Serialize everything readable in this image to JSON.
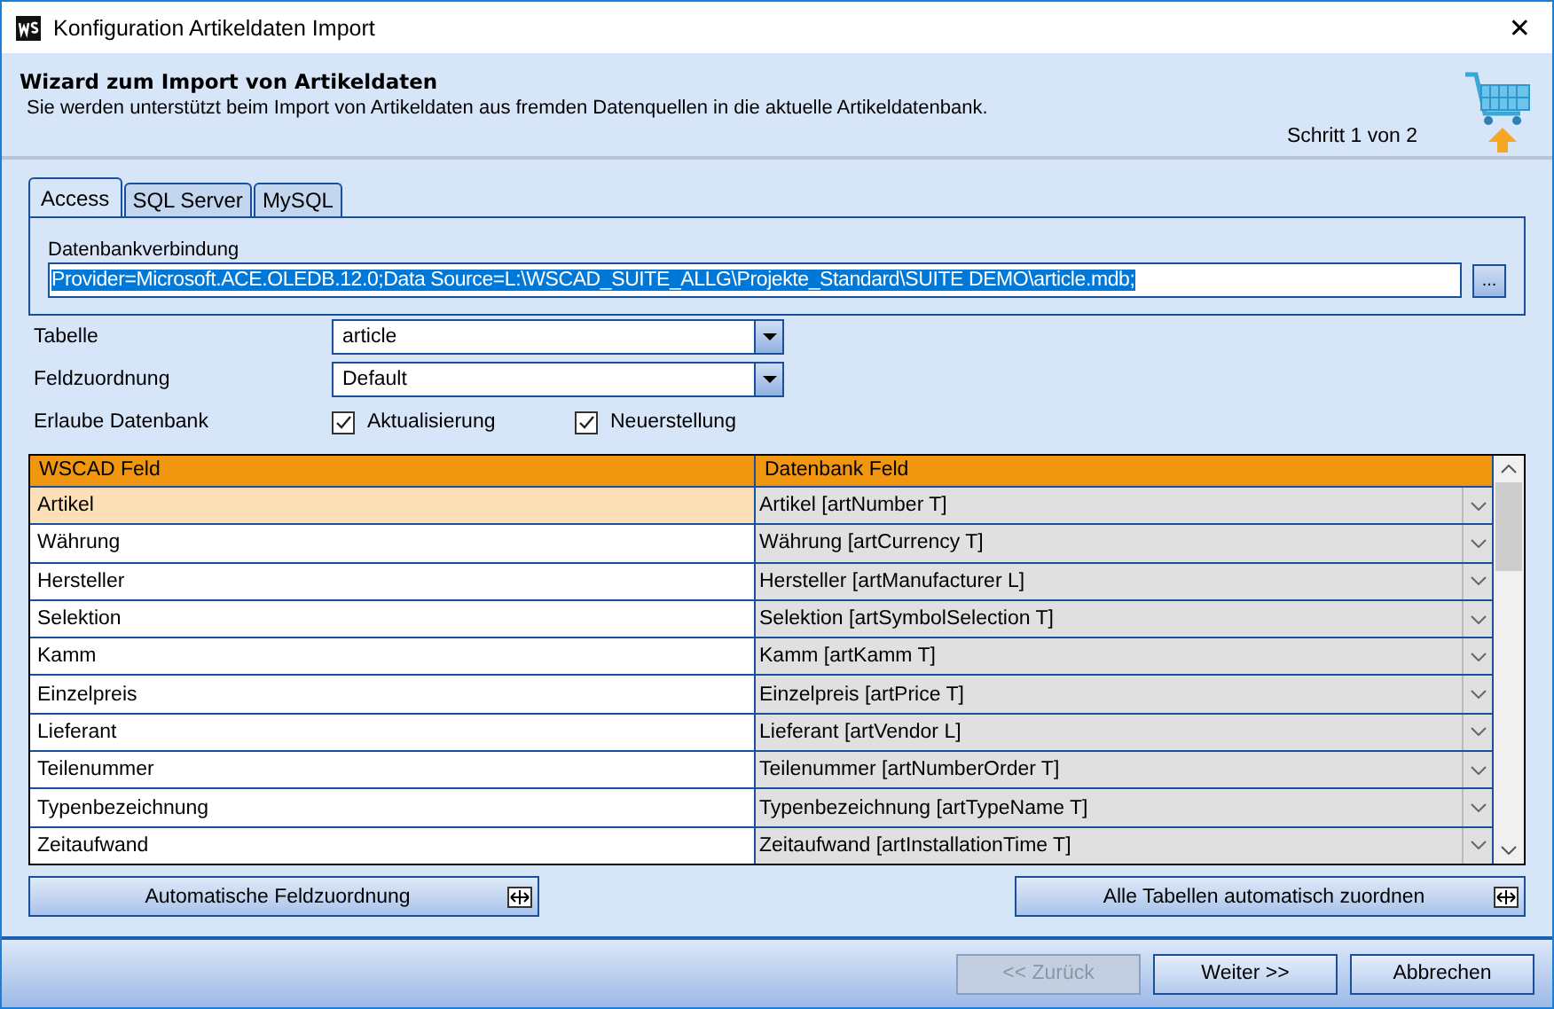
{
  "window": {
    "title": "Konfiguration Artikeldaten Import",
    "close": "✕"
  },
  "header": {
    "title": "Wizard zum Import von Artikeldaten",
    "subtitle": "Sie werden unterstützt beim Import von Artikeldaten aus fremden Datenquellen in die aktuelle Artikeldatenbank.",
    "step": "Schritt 1 von 2"
  },
  "tabs": [
    {
      "label": "Access",
      "selected": true
    },
    {
      "label": "SQL Server",
      "selected": false
    },
    {
      "label": "MySQL",
      "selected": false
    }
  ],
  "connection": {
    "label": "Datenbankverbindung",
    "value": "Provider=Microsoft.ACE.OLEDB.12.0;Data Source=L:\\WSCAD_SUITE_ALLG\\Projekte_Standard\\SUITE DEMO\\article.mdb;",
    "browse": "..."
  },
  "fields": [
    {
      "label": "Tabelle",
      "value": "article"
    },
    {
      "label": "Feldzuordnung",
      "value": "Default"
    }
  ],
  "allow": {
    "label": "Erlaube Datenbank",
    "options": [
      {
        "label": "Aktualisierung",
        "checked": true
      },
      {
        "label": "Neuerstellung",
        "checked": true
      }
    ]
  },
  "table": {
    "columns": [
      "WSCAD Feld",
      "Datenbank Feld"
    ],
    "rows": [
      {
        "field": "Artikel",
        "db": "Artikel [artNumber T]",
        "selected": true
      },
      {
        "field": "Währung",
        "db": "Währung [artCurrency T]",
        "selected": false
      },
      {
        "field": "Hersteller",
        "db": "Hersteller [artManufacturer L]",
        "selected": false
      },
      {
        "field": "Selektion",
        "db": "Selektion [artSymbolSelection T]",
        "selected": false
      },
      {
        "field": "Kamm",
        "db": "Kamm [artKamm T]",
        "selected": false
      },
      {
        "field": "Einzelpreis",
        "db": "Einzelpreis [artPrice T]",
        "selected": false
      },
      {
        "field": "Lieferant",
        "db": "Lieferant [artVendor L]",
        "selected": false
      },
      {
        "field": "Teilenummer",
        "db": "Teilenummer [artNumberOrder T]",
        "selected": false
      },
      {
        "field": "Typenbezeichnung",
        "db": "Typenbezeichnung [artTypeName T]",
        "selected": false
      },
      {
        "field": "Zeitaufwand",
        "db": "Zeitaufwand [artInstallationTime T]",
        "selected": false
      }
    ]
  },
  "actions": [
    "Automatische Feldzuordnung",
    "Alle Tabellen automatisch zuordnen"
  ],
  "buttons": [
    {
      "label": "<< Zurück",
      "disabled": true
    },
    {
      "label": "Weiter >>",
      "disabled": false
    },
    {
      "label": "Abbrechen",
      "disabled": false
    }
  ]
}
